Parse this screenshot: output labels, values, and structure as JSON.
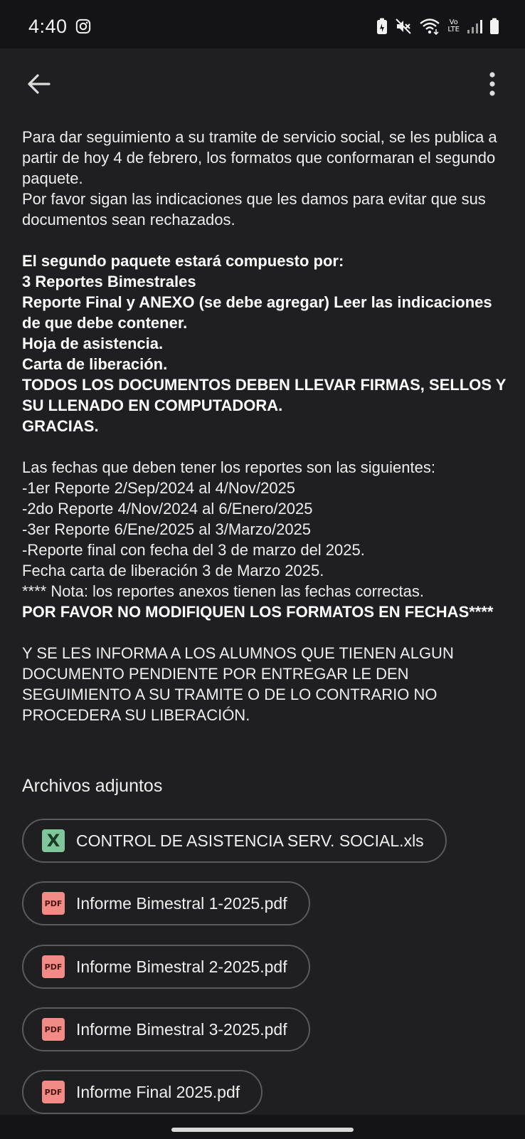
{
  "status_bar": {
    "time": "4:40",
    "icons": [
      "instagram-icon",
      "battery-saver-icon",
      "mute-icon",
      "wifi-icon",
      "volte-icon",
      "signal-icon",
      "battery-icon"
    ],
    "volte_top": "Vo",
    "volte_bottom": "LTE"
  },
  "app_bar": {
    "back_icon": "arrow-back-icon",
    "more_icon": "more-vert-icon"
  },
  "message": {
    "para1": "Para dar seguimiento a su tramite de servicio social, se les publica a partir de hoy 4 de febrero, los formatos que conformaran el segundo paquete.\nPor favor sigan las indicaciones que les damos para evitar que sus documentos sean rechazados.",
    "para2": "El segundo paquete estará compuesto por:\n3 Reportes Bimestrales\nReporte Final y ANEXO (se debe agregar) Leer las indicaciones de que debe contener.\nHoja de asistencia.\nCarta de liberación.\nTODOS LOS DOCUMENTOS DEBEN LLEVAR FIRMAS, SELLOS Y SU LLENADO EN COMPUTADORA.\nGRACIAS.",
    "para3": "Las fechas que deben tener los reportes son las siguientes:\n-1er Reporte 2/Sep/2024 al 4/Nov/2025\n-2do Reporte 4/Nov/2024 al 6/Enero/2025\n-3er Reporte 6/Ene/2025 al 3/Marzo/2025\n-Reporte final con fecha del 3 de marzo del 2025.\nFecha carta de liberación 3 de Marzo 2025.\n**** Nota: los reportes anexos tienen las fechas correctas.",
    "para3_bold": "POR FAVOR NO MODIFIQUEN LOS FORMATOS EN FECHAS****",
    "para4": "Y SE LES INFORMA A LOS ALUMNOS QUE TIENEN ALGUN DOCUMENTO PENDIENTE POR ENTREGAR LE DEN SEGUIMIENTO A SU TRAMITE O DE LO CONTRARIO NO PROCEDERA SU LIBERACIÓN."
  },
  "attachments": {
    "title": "Archivos adjuntos",
    "files": [
      {
        "name": "CONTROL DE ASISTENCIA SERV. SOCIAL.xls",
        "icon": "excel-file-icon",
        "icon_label": "X"
      },
      {
        "name": "Informe Bimestral 1-2025.pdf",
        "icon": "pdf-file-icon",
        "icon_label": "PDF"
      },
      {
        "name": "Informe Bimestral 2-2025.pdf",
        "icon": "pdf-file-icon",
        "icon_label": "PDF"
      },
      {
        "name": "Informe Bimestral 3-2025.pdf",
        "icon": "pdf-file-icon",
        "icon_label": "PDF"
      },
      {
        "name": "Informe Final 2025.pdf",
        "icon": "pdf-file-icon",
        "icon_label": "PDF"
      }
    ]
  },
  "colors": {
    "background": "#1f1f22",
    "status_bar": "#141416",
    "text": "#eeeeee",
    "chip_border": "#5a5a5e",
    "excel_icon": "#7fc79a",
    "pdf_icon": "#f08b85"
  }
}
